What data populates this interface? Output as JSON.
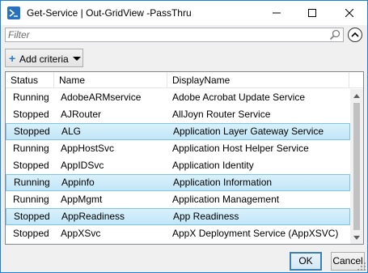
{
  "window": {
    "title": "Get-Service | Out-GridView -PassThru",
    "icon": "powershell-icon",
    "controls": [
      "minimize-icon",
      "maximize-icon",
      "close-icon"
    ]
  },
  "filter": {
    "placeholder": "Filter",
    "value": ""
  },
  "toolbar": {
    "add_criteria_label": "Add criteria"
  },
  "grid": {
    "columns": [
      "Status",
      "Name",
      "DisplayName"
    ],
    "rows": [
      {
        "status": "Running",
        "name": "AdobeARMservice",
        "display": "Adobe Acrobat Update Service",
        "selected": false
      },
      {
        "status": "Stopped",
        "name": "AJRouter",
        "display": "AllJoyn Router Service",
        "selected": false
      },
      {
        "status": "Stopped",
        "name": "ALG",
        "display": "Application Layer Gateway Service",
        "selected": true
      },
      {
        "status": "Running",
        "name": "AppHostSvc",
        "display": "Application Host Helper Service",
        "selected": false
      },
      {
        "status": "Stopped",
        "name": "AppIDSvc",
        "display": "Application Identity",
        "selected": false
      },
      {
        "status": "Running",
        "name": "Appinfo",
        "display": "Application Information",
        "selected": true
      },
      {
        "status": "Running",
        "name": "AppMgmt",
        "display": "Application Management",
        "selected": false
      },
      {
        "status": "Stopped",
        "name": "AppReadiness",
        "display": "App Readiness",
        "selected": true
      },
      {
        "status": "Stopped",
        "name": "AppXSvc",
        "display": "AppX Deployment Service (AppXSVC)",
        "selected": false
      }
    ]
  },
  "buttons": {
    "ok": "OK",
    "cancel": "Cancel"
  },
  "colors": {
    "accent": "#1883d7",
    "selection": "#c2e6f8",
    "selection_border": "#7bc5ea"
  }
}
